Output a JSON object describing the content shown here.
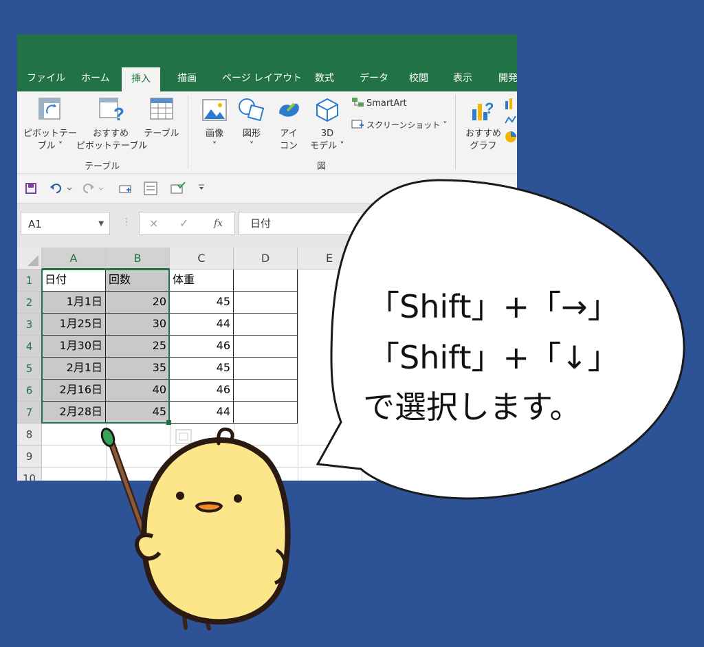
{
  "ribbon_tabs": [
    "ファイル",
    "ホーム",
    "挿入",
    "描画",
    "ページ レイアウト",
    "数式",
    "データ",
    "校閲",
    "表示",
    "開発"
  ],
  "active_tab": "挿入",
  "ribbon": {
    "pivot_table": [
      "ピボットテー",
      "ブル ˅"
    ],
    "recommended_pivot": [
      "おすすめ",
      "ピボットテーブル"
    ],
    "table": "テーブル",
    "group_table": "テーブル",
    "image": [
      "画像",
      "˅"
    ],
    "shapes": [
      "図形",
      "˅"
    ],
    "icons": [
      "アイ",
      "コン"
    ],
    "model3d": [
      "3D",
      "モデル ˅"
    ],
    "smartart": "SmartArt",
    "screenshot": "スクリーンショット ˅",
    "group_illust": "図",
    "recommended_chart": [
      "おすすめ",
      "グラフ"
    ]
  },
  "formula_bar": {
    "name_box": "A1",
    "fx_cancel": "×",
    "fx_enter": "✓",
    "fx_label": "fx",
    "value": "日付"
  },
  "grid": {
    "columns": [
      "A",
      "B",
      "C",
      "D",
      "E"
    ],
    "rows": [
      "1",
      "2",
      "3",
      "4",
      "5",
      "6",
      "7",
      "8",
      "9",
      "10"
    ],
    "header": [
      "日付",
      "回数",
      "体重"
    ],
    "data": [
      [
        "1月1日",
        "20",
        "45"
      ],
      [
        "1月25日",
        "30",
        "44"
      ],
      [
        "1月30日",
        "25",
        "46"
      ],
      [
        "2月1日",
        "35",
        "45"
      ],
      [
        "2月16日",
        "40",
        "46"
      ],
      [
        "2月28日",
        "45",
        "44"
      ]
    ]
  },
  "bubble": {
    "line1": "「Shift」+「→」",
    "line2": "「Shift」+「↓」",
    "line3": "で選択します。"
  },
  "colors": {
    "background": "#2e5296",
    "excel_green": "#217346",
    "selection": "#c9c9c9",
    "chick": "#fbe58a"
  }
}
